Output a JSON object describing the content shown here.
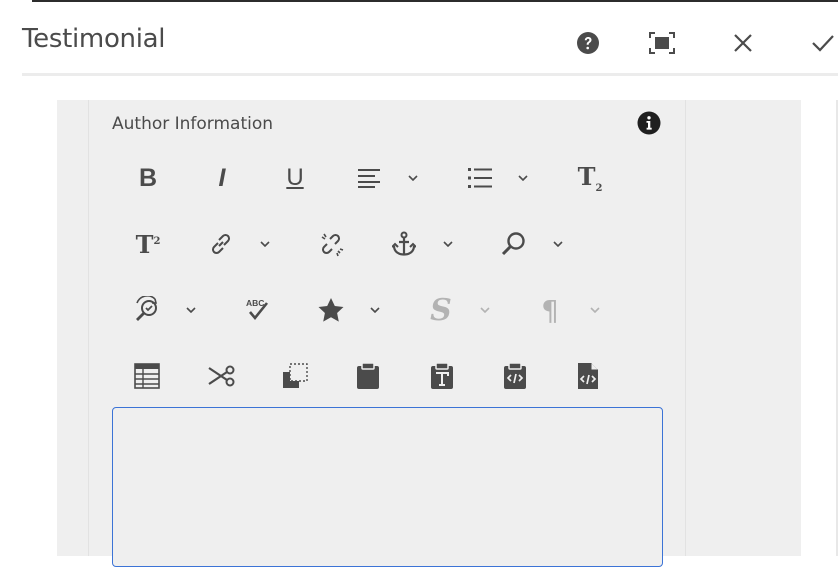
{
  "dialog": {
    "title": "Testimonial",
    "actions": [
      {
        "name": "help",
        "icon": "help-icon"
      },
      {
        "name": "fullscreen",
        "icon": "fullscreen-icon"
      },
      {
        "name": "cancel",
        "icon": "close-icon"
      },
      {
        "name": "done",
        "icon": "checkmark-icon"
      }
    ]
  },
  "field": {
    "label": "Author Information",
    "info_icon": "info-icon",
    "editor_value": ""
  },
  "toolbar": {
    "rows": [
      [
        "bold",
        "italic",
        "underline",
        "justify-dropdown",
        "list-dropdown",
        "subscript"
      ],
      [
        "superscript",
        "link-dropdown",
        "unlink",
        "anchor-dropdown",
        "find-dropdown"
      ],
      [
        "find-replace-dropdown",
        "spellcheck",
        "special-chars-dropdown",
        "styles-dropdown-disabled",
        "paragraph-dropdown-disabled"
      ],
      [
        "table",
        "cut",
        "copy",
        "paste",
        "paste-plaintext",
        "paste-wordhtml",
        "source-edit"
      ]
    ],
    "text_glyphs": {
      "bold": "B",
      "italic": "I",
      "underline": "U",
      "subscript_base": "T",
      "subscript_sub": "2",
      "superscript_base": "T",
      "superscript_sup": "2",
      "spell_abc": "ABC",
      "styles": "S",
      "paragraph": "¶"
    }
  },
  "colors": {
    "icon": "#4b4b4b",
    "icon_disabled": "#b3b3b3",
    "focus": "#3b73d6",
    "canvas": "#efefef"
  }
}
